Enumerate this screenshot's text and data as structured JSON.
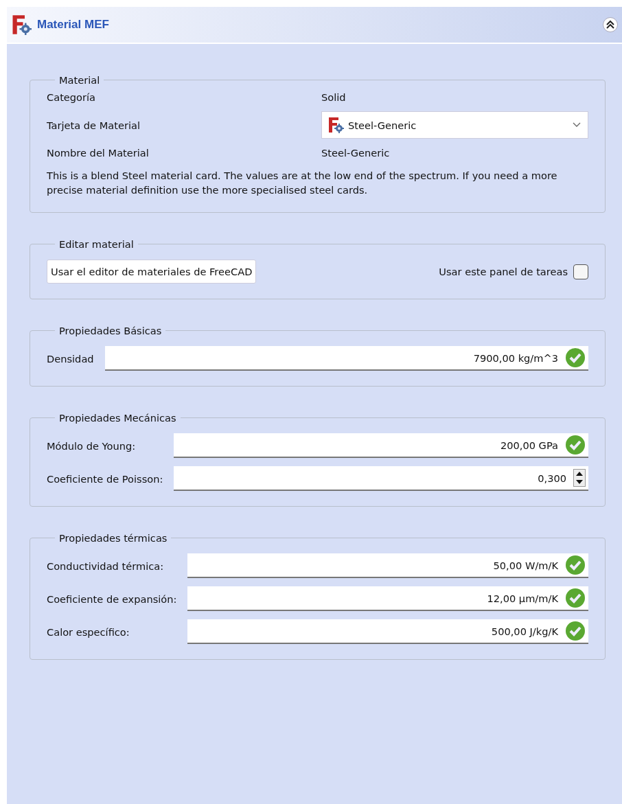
{
  "header": {
    "title": "Material MEF",
    "collapsed": false
  },
  "material": {
    "legend": "Material",
    "rows": [
      {
        "label": "Categoría",
        "kind": "text",
        "value": "Solid"
      },
      {
        "label": "Tarjeta de Material",
        "kind": "combo",
        "value": "Steel-Generic"
      },
      {
        "label": "Nombre del Material",
        "kind": "text",
        "value": "Steel-Generic"
      }
    ],
    "description": "This is a blend Steel material card. The values are at the low end of the spectrum. If you need a more precise material definition use the more specialised steel cards."
  },
  "edit": {
    "legend": "Editar material",
    "button": "Usar el editor de materiales de FreeCAD",
    "checkbox": {
      "label": "Usar este panel de tareas",
      "checked": false
    }
  },
  "groups": [
    {
      "legend": "Propiedades Básicas",
      "fields": [
        {
          "label": "Densidad",
          "value": "7900,00 kg/m^3",
          "kind": "check"
        }
      ]
    },
    {
      "legend": "Propiedades Mecánicas",
      "fields": [
        {
          "label": "Módulo de Young:",
          "value": "200,00 GPa",
          "kind": "check"
        },
        {
          "label": "Coeficiente de Poisson:",
          "value": "0,300",
          "kind": "spin"
        }
      ]
    },
    {
      "legend": "Propiedades térmicas",
      "fields": [
        {
          "label": "Conductividad térmica:",
          "value": "50,00 W/m/K",
          "kind": "check"
        },
        {
          "label": "Coeficiente de expansión:",
          "value": "12,00 µm/m/K",
          "kind": "check"
        },
        {
          "label": "Calor específico:",
          "value": "500,00 J/kg/K",
          "kind": "check"
        }
      ]
    }
  ]
}
